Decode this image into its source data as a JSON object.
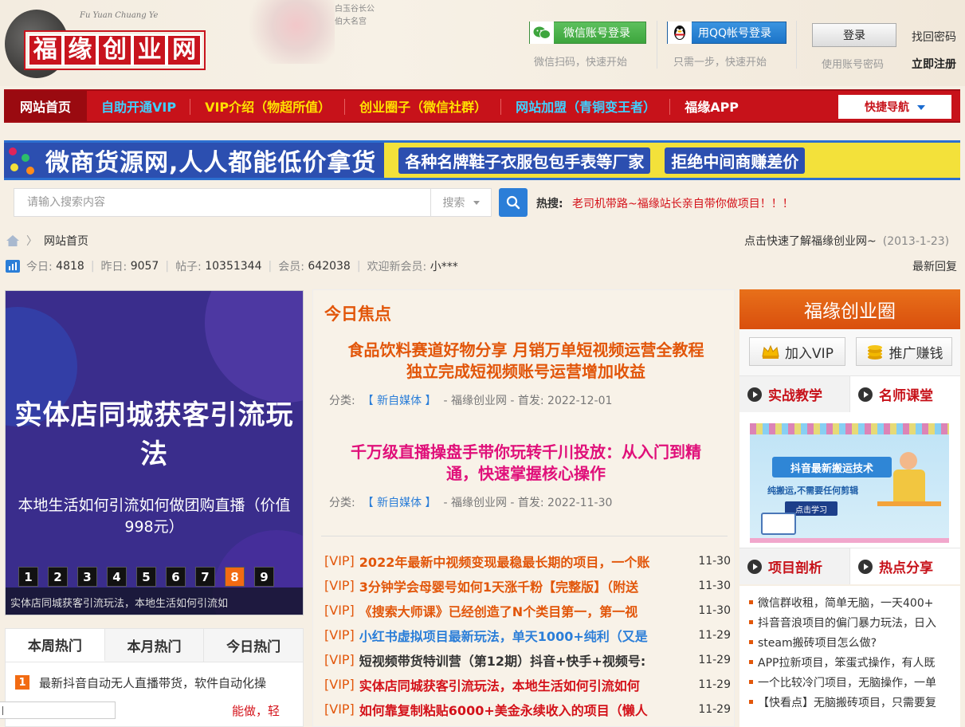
{
  "header": {
    "logo_chars": [
      "福",
      "缘",
      "创",
      "业",
      "网"
    ],
    "logo_pinyin": "Fu Yuan Chuang Ye",
    "calligraphy": [
      "白玉谷长公",
      "伯大名宫"
    ],
    "wechat_login": "微信账号登录",
    "wechat_sub": "微信扫码，快速开始",
    "qq_login": "用QQ帐号登录",
    "qq_sub": "只需一步，快速开始",
    "login": "登录",
    "use_account": "使用账号密码",
    "forgot_password": "找回密码",
    "register": "立即注册"
  },
  "nav": {
    "items": [
      {
        "label": "网站首页",
        "color": "#ffffff"
      },
      {
        "label": "自助开通VIP",
        "color": "#3fd0ff"
      },
      {
        "label": "VIP介绍（物超所值）",
        "color": "#ffe000"
      },
      {
        "label": "创业圈子（微信社群）",
        "color": "#ffe000"
      },
      {
        "label": "网站加盟（青铜变王者）",
        "color": "#3fd0ff"
      },
      {
        "label": "福缘APP",
        "color": "#ffffff"
      }
    ],
    "quick_nav": "快捷导航"
  },
  "banner": {
    "main": "微商货源网,人人都能低价拿货",
    "tag1": "各种名牌鞋子衣服包包手表等厂家",
    "tag2": "拒绝中间商赚差价"
  },
  "search": {
    "placeholder": "请输入搜索内容",
    "type": "搜索",
    "hot_label": "热搜:",
    "hot_link": "老司机带路~福缘站长亲自带你做项目！！！"
  },
  "breadcrumb": {
    "home": "网站首页",
    "right_text": "点击快速了解福缘创业网~",
    "right_date": "(2013-1-23)"
  },
  "stats": {
    "today_label": "今日:",
    "today": "4818",
    "yesterday_label": "昨日:",
    "yesterday": "9057",
    "posts_label": "帖子:",
    "posts": "10351344",
    "members_label": "会员:",
    "members": "642038",
    "welcome_label": "欢迎新会员:",
    "welcome": "小***",
    "latest_reply": "最新回复"
  },
  "slider": {
    "title": "实体店同城获客引流玩法",
    "subtitle": "本地生活如何引流如何做团购直播（价值998元）",
    "numbers": [
      "1",
      "2",
      "3",
      "4",
      "5",
      "6",
      "7",
      "8",
      "9"
    ],
    "active_index": 8,
    "caption": "实体店同城获客引流玩法，本地生活如何引流如"
  },
  "hot_tabs": {
    "tabs": [
      "本周热门",
      "本月热门",
      "今日热门"
    ],
    "active": 0,
    "items": [
      {
        "rank": "1",
        "title": "最新抖音自动无人直播带货，软件自动化操"
      },
      {
        "rank": "",
        "title": "能做，轻"
      }
    ]
  },
  "focus": {
    "title": "今日焦点",
    "headlines": [
      {
        "title_line1": "食品饮料赛道好物分享 月销万单短视频运营全教程",
        "title_line2": "独立完成短视频账号运营增加收益",
        "color": "#e2560a",
        "cat_label": "分类:",
        "cat": "【 新自媒体 】",
        "meta": "- 福缘创业网 - 首发: 2022-12-01"
      },
      {
        "title_line1": "千万级直播操盘手带你玩转千川投放：从入门到精",
        "title_line2": "通，快速掌握核心操作",
        "color": "#e0107a",
        "cat_label": "分类:",
        "cat": "【 新自媒体 】",
        "meta": "- 福缘创业网 - 首发: 2022-11-30"
      }
    ],
    "vip_items": [
      {
        "tag": "[VIP]",
        "title": "2022年最新中视频变现最稳最长期的项目，一个账",
        "date": "11-30",
        "color": "#e2560a"
      },
      {
        "tag": "[VIP]",
        "title": "3分钟学会母婴号如何1天涨千粉【完整版】（附送",
        "date": "11-30",
        "color": "#e2560a"
      },
      {
        "tag": "[VIP]",
        "title": "《搜索大师课》已经创造了N个类目第一，第一视",
        "date": "11-30",
        "color": "#e2560a"
      },
      {
        "tag": "[VIP]",
        "title": "小红书虚拟项目最新玩法，单天1000+纯利（又是",
        "date": "11-29",
        "color": "#2b7ed8"
      },
      {
        "tag": "[VIP]",
        "title": "短视频带货特训营（第12期）抖音+快手+视频号:",
        "date": "11-29",
        "color": "#333333"
      },
      {
        "tag": "[VIP]",
        "title": "实体店同城获客引流玩法，本地生活如何引流如何",
        "date": "11-29",
        "color": "#d4121a"
      },
      {
        "tag": "[VIP]",
        "title": "如何靠复制粘贴6000+美金永续收入的项目（懒人",
        "date": "11-29",
        "color": "#d4121a"
      }
    ]
  },
  "right": {
    "circle_title": "福缘创业圈",
    "join_vip": "加入VIP",
    "promote": "推广赚钱",
    "tabs1": [
      "实战教学",
      "名师课堂"
    ],
    "promo": {
      "line1": "抖音最新搬运技术",
      "line2": "纯搬运,不需要任何剪辑",
      "btn": "点击学习"
    },
    "tabs2": [
      "项目剖析",
      "热点分享"
    ],
    "articles": [
      "微信群收租，简单无脑，一天400+",
      "抖音音浪项目的偏门暴力玩法，日入",
      "steam搬砖项目怎么做?",
      "APP拉新项目，笨蛋式操作，有人既",
      "一个比较冷门项目，无脑操作，一单",
      "【快看点】无脑搬砖项目，只需要复"
    ]
  }
}
